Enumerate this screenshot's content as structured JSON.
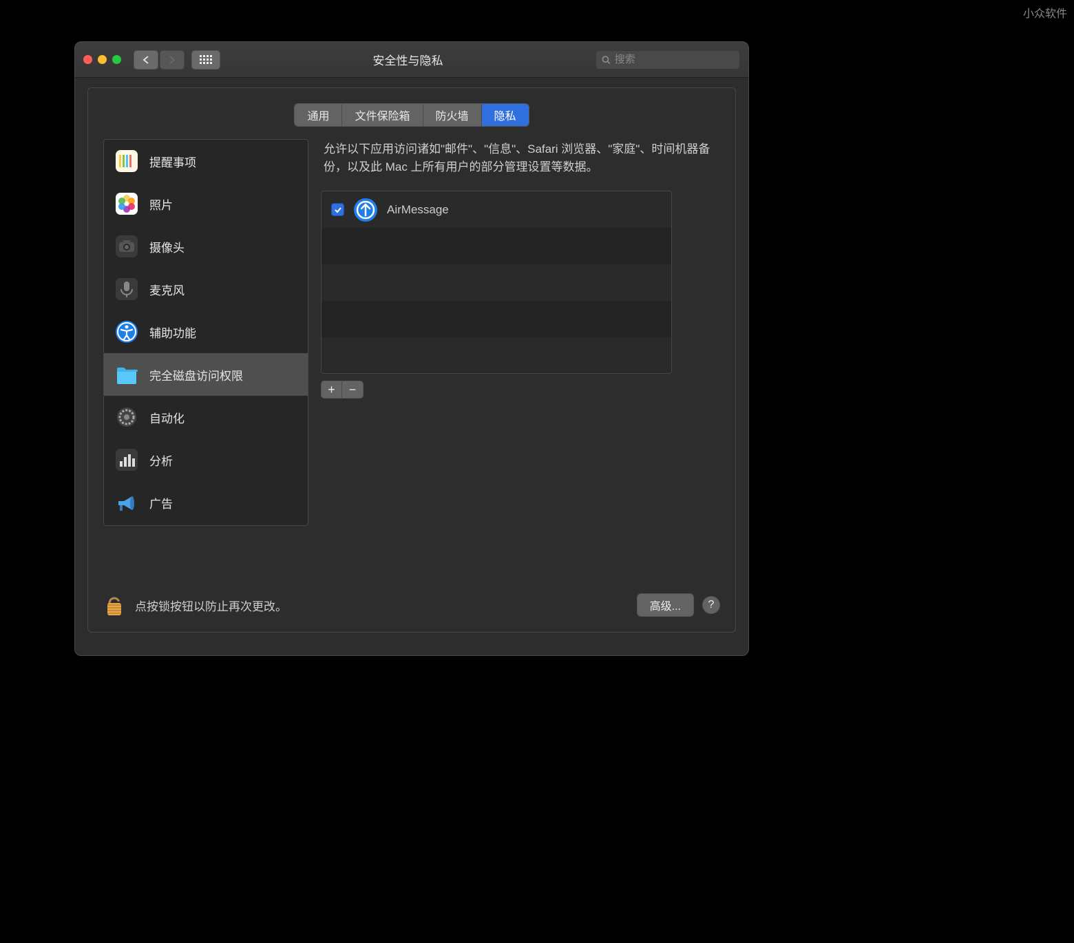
{
  "watermark": "小众软件",
  "window": {
    "title": "安全性与隐私",
    "search_placeholder": "搜索"
  },
  "tabs": [
    {
      "label": "通用",
      "active": false
    },
    {
      "label": "文件保险箱",
      "active": false
    },
    {
      "label": "防火墙",
      "active": false
    },
    {
      "label": "隐私",
      "active": true
    }
  ],
  "sidebar": {
    "items": [
      {
        "label": "提醒事项",
        "icon": "reminders"
      },
      {
        "label": "照片",
        "icon": "photos"
      },
      {
        "label": "摄像头",
        "icon": "camera"
      },
      {
        "label": "麦克风",
        "icon": "microphone"
      },
      {
        "label": "辅助功能",
        "icon": "accessibility"
      },
      {
        "label": "完全磁盘访问权限",
        "icon": "folder",
        "selected": true
      },
      {
        "label": "自动化",
        "icon": "automation"
      },
      {
        "label": "分析",
        "icon": "analytics"
      },
      {
        "label": "广告",
        "icon": "ads"
      }
    ]
  },
  "description": "允许以下应用访问诸如\"邮件\"、\"信息\"、Safari 浏览器、\"家庭\"、时间机器备份，以及此 Mac 上所有用户的部分管理设置等数据。",
  "apps": [
    {
      "name": "AirMessage",
      "checked": true
    }
  ],
  "footer": {
    "lock_text": "点按锁按钮以防止再次更改。",
    "advanced": "高级...",
    "help": "?"
  },
  "toolbar": {
    "plus": "+",
    "minus": "−"
  }
}
